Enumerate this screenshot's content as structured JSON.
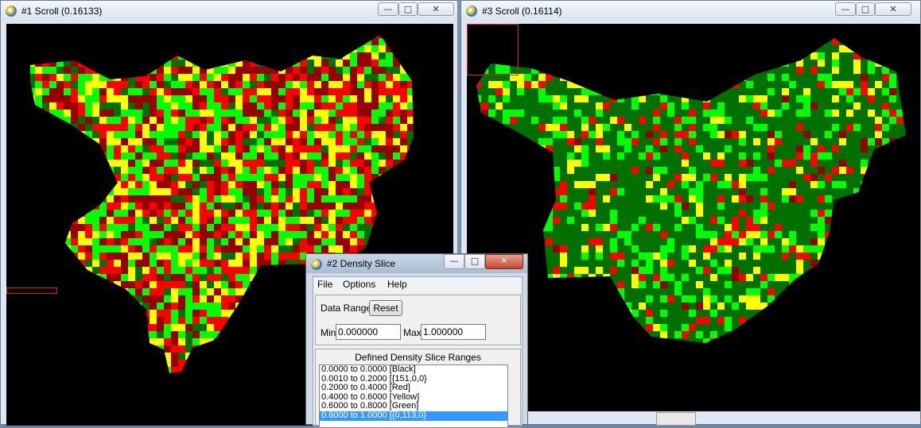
{
  "window1": {
    "title": "#1 Scroll (0.16133)"
  },
  "window3": {
    "title": "#3 Scroll (0.16114)"
  },
  "window_controls": {
    "minimize": "—",
    "maximize": "□",
    "close": "✕"
  },
  "dialog": {
    "title": "#2 Density Slice",
    "menu": [
      "File",
      "Options",
      "Help"
    ],
    "data_range_label": "Data Range",
    "reset_label": "Reset",
    "min_label": "Min",
    "min_value": "0.000000",
    "max_label": "Max",
    "max_value": "1.000000",
    "ranges_header": "Defined Density Slice Ranges",
    "ranges": [
      "0.0000 to 0.0000 [Black]",
      "0.0010 to 0.2000 [{151,0,0}",
      "0.2000 to 0.4000 [Red]",
      "0.4000 to 0.6000 [Yellow]",
      "0.6000 to 0.8000 [Green]",
      "0.8000 to 1.0000 [{0,113,0}"
    ],
    "selected_index": 5
  },
  "colors": {
    "black": "#000000",
    "dark_red": "#970000",
    "red": "#ff0000",
    "yellow": "#ffff00",
    "green": "#00ff00",
    "dark_green": "#007100",
    "selection": "#3399ff"
  },
  "map1_mix": [
    0.25,
    0.22,
    0.18,
    0.25,
    0.1
  ],
  "map3_mix": [
    0.03,
    0.09,
    0.1,
    0.18,
    0.6
  ]
}
